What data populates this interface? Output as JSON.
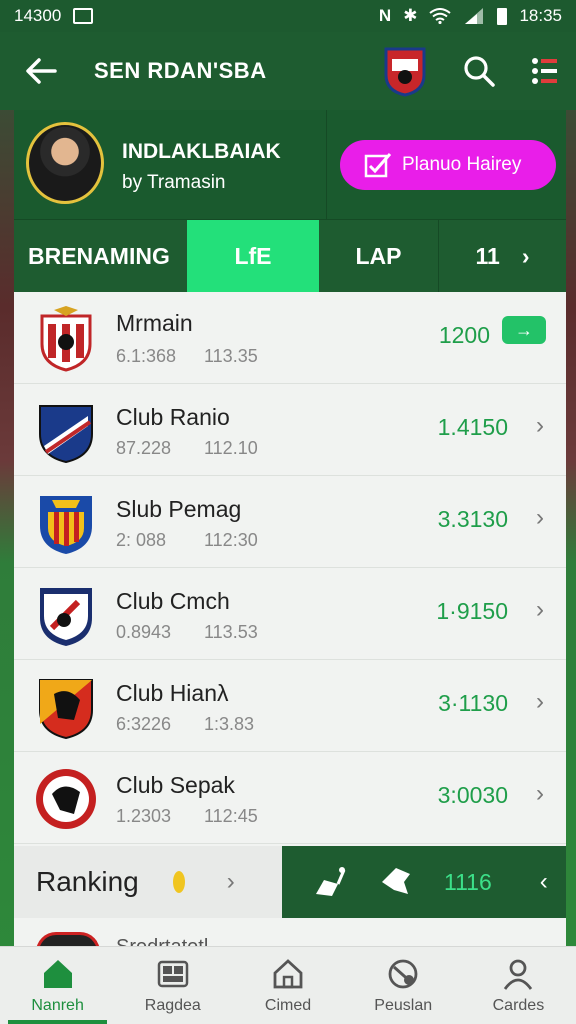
{
  "status_bar": {
    "left_time": "14300",
    "right_time": "18:35",
    "n_glyph": "N",
    "bt_glyph": "✱"
  },
  "app_bar": {
    "title": "SEN RDAN'SBA",
    "back_icon": "arrow-left-icon",
    "search_icon": "search-icon",
    "menu_icon": "menu-icon"
  },
  "profile": {
    "name": "INDLAKLBAIAK",
    "subtitle": "by Tramasin",
    "promo_button": "Planuo Hairey"
  },
  "tabs": [
    {
      "label": "BRENAMING",
      "active": false
    },
    {
      "label": "LfE",
      "active": true
    },
    {
      "label": "LAP",
      "active": false
    },
    {
      "label": "11",
      "active": false
    }
  ],
  "rows": [
    {
      "name": "Mrmain",
      "meta1": "6.1:368",
      "meta2": "113.35",
      "score": "1200",
      "action": "green-pill"
    },
    {
      "name": "Club Ranio",
      "meta1": "87.228",
      "meta2": "112.10",
      "score": "1.4150",
      "action": "chevron"
    },
    {
      "name": "Slub Pemag",
      "meta1": "2: 088",
      "meta2": "112:30",
      "score": "3.3130",
      "action": "chevron"
    },
    {
      "name": "Club Cmch",
      "meta1": "0.8943",
      "meta2": "113.53",
      "score": "1·9150",
      "action": "chevron"
    },
    {
      "name": "Club Hianλ",
      "meta1": "6:3226",
      "meta2": "1:3.83",
      "score": "3·1130",
      "action": "chevron"
    },
    {
      "name": "Club Sepak",
      "meta1": "1.2303",
      "meta2": "112:45",
      "score": "3:0030",
      "action": "chevron"
    }
  ],
  "row_action_glyphs": {
    "chevron": "›",
    "pill": "→"
  },
  "bottom_bar": {
    "ranking_label": "Ranking",
    "count": "1116",
    "chevron": "›",
    "back": "‹"
  },
  "peek_row": {
    "text": "Sredrtatetl"
  },
  "nav": [
    {
      "label": "Nanreh",
      "icon": "home-icon",
      "active": true
    },
    {
      "label": "Ragdea",
      "icon": "grid-icon",
      "active": false
    },
    {
      "label": "Cimed",
      "icon": "house-outline-icon",
      "active": false
    },
    {
      "label": "Peuslan",
      "icon": "ball-icon",
      "active": false
    },
    {
      "label": "Cardes",
      "icon": "user-icon",
      "active": false
    }
  ],
  "colors": {
    "app_bar": "#1e5c30",
    "active_tab": "#23e07a",
    "promo": "#e91ee9",
    "score": "#1f9e4a",
    "accent": "#1e8f3e"
  }
}
